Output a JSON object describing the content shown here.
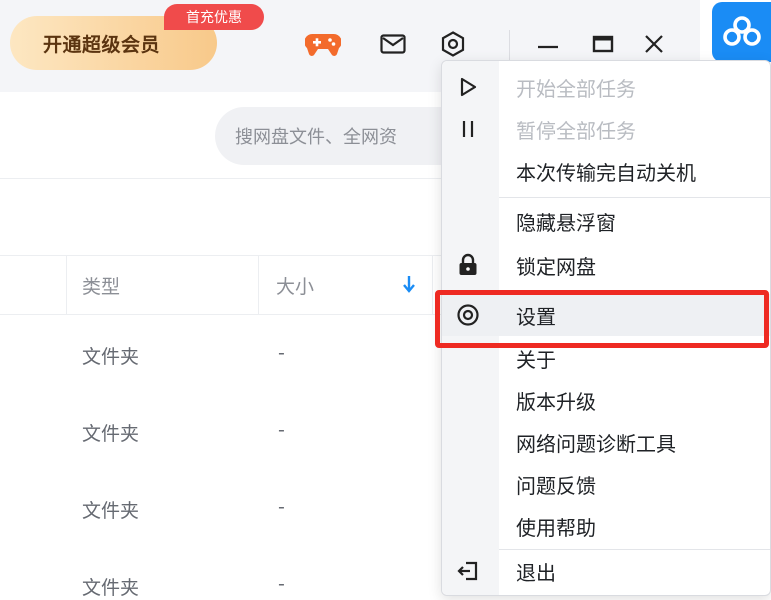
{
  "titlebar": {
    "vip_label": "开通超级会员",
    "promo_badge": "首充优惠",
    "icons": [
      "gamepad-icon",
      "mail-icon",
      "settings-icon",
      "minimize-icon",
      "maximize-icon",
      "close-icon"
    ]
  },
  "search": {
    "placeholder": "搜网盘文件、全网资"
  },
  "table": {
    "headers": {
      "type": "类型",
      "size": "大小"
    },
    "rows": [
      {
        "type": "文件夹",
        "size": "-"
      },
      {
        "type": "文件夹",
        "size": "-"
      },
      {
        "type": "文件夹",
        "size": "-"
      },
      {
        "type": "文件夹",
        "size": "-"
      }
    ]
  },
  "menu": {
    "items": [
      {
        "label": "开始全部任务",
        "icon": "play-icon",
        "disabled": true
      },
      {
        "label": "暂停全部任务",
        "icon": "pause-icon",
        "disabled": true
      },
      {
        "label": "本次传输完自动关机",
        "icon": "",
        "disabled": false
      },
      {
        "label": "隐藏悬浮窗",
        "icon": "",
        "disabled": false
      },
      {
        "label": "锁定网盘",
        "icon": "lock-icon",
        "disabled": false
      },
      {
        "label": "设置",
        "icon": "settings-icon",
        "disabled": false
      },
      {
        "label": "关于",
        "icon": "",
        "disabled": false
      },
      {
        "label": "版本升级",
        "icon": "",
        "disabled": false
      },
      {
        "label": "网络问题诊断工具",
        "icon": "",
        "disabled": false
      },
      {
        "label": "问题反馈",
        "icon": "",
        "disabled": false
      },
      {
        "label": "使用帮助",
        "icon": "",
        "disabled": false
      },
      {
        "label": "退出",
        "icon": "exit-icon",
        "disabled": false
      }
    ]
  },
  "colors": {
    "accent": "#1a8cf5",
    "highlight": "#ee2a22",
    "promo": "#f04b4b"
  }
}
